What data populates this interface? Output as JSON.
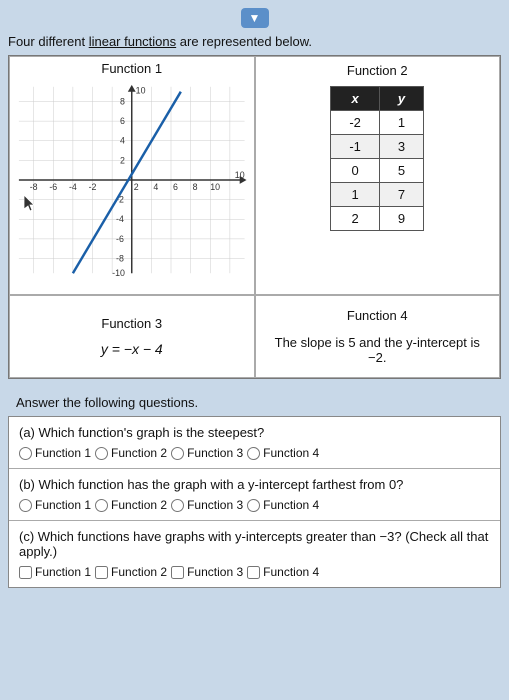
{
  "topbar": {
    "chevron": "▼"
  },
  "intro": {
    "text_before": "Four different ",
    "link": "linear functions",
    "text_after": " are represented below."
  },
  "function1": {
    "title": "Function 1"
  },
  "function2": {
    "title": "Function 2",
    "col_x": "x",
    "col_y": "y",
    "rows": [
      {
        "x": "-2",
        "y": "1"
      },
      {
        "x": "-1",
        "y": "3"
      },
      {
        "x": "0",
        "y": "5"
      },
      {
        "x": "1",
        "y": "7"
      },
      {
        "x": "2",
        "y": "9"
      }
    ]
  },
  "function3": {
    "title": "Function 3",
    "equation": "y = −x − 4"
  },
  "function4": {
    "title": "Function 4",
    "description": "The slope is 5 and the y-intercept is −2."
  },
  "answer_intro": "Answer the following questions.",
  "questions": [
    {
      "id": "a",
      "text": "(a) Which function's graph is the steepest?",
      "type": "radio",
      "options": [
        "Function 1",
        "Function 2",
        "Function 3",
        "Function 4"
      ]
    },
    {
      "id": "b",
      "text": "(b) Which function has the graph with a y-intercept farthest from 0?",
      "type": "radio",
      "options": [
        "Function 1",
        "Function 2",
        "Function 3",
        "Function 4"
      ]
    },
    {
      "id": "c",
      "text": "(c) Which functions have graphs with y-intercepts greater than −3? (Check all that apply.)",
      "type": "checkbox",
      "options": [
        "Function 1",
        "Function 2",
        "Function 3",
        "Function 4"
      ]
    }
  ]
}
